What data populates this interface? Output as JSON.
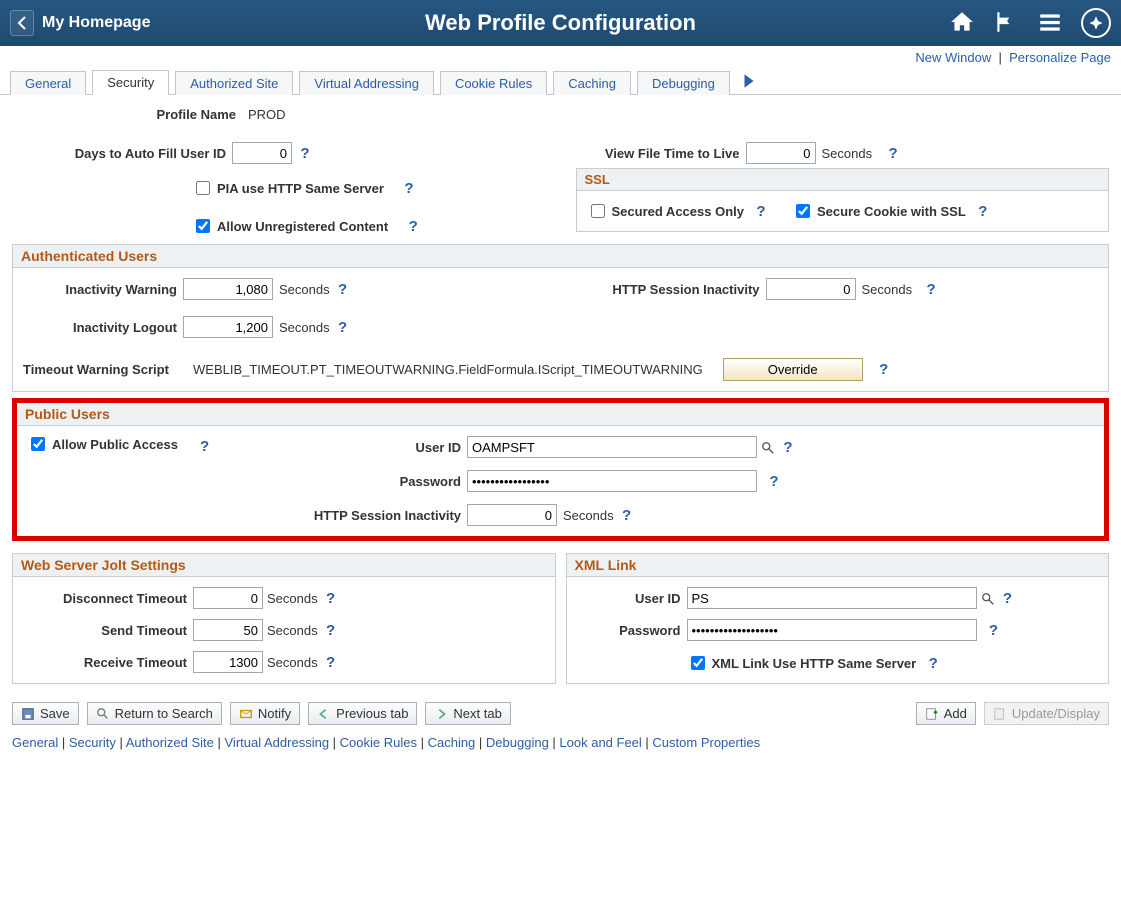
{
  "header": {
    "homepage_label": "My Homepage",
    "page_title": "Web Profile Configuration"
  },
  "toplinks": {
    "new_window": "New Window",
    "personalize": "Personalize Page"
  },
  "tabs": {
    "items": [
      "General",
      "Security",
      "Authorized Site",
      "Virtual Addressing",
      "Cookie Rules",
      "Caching",
      "Debugging"
    ],
    "active_index": 1
  },
  "profile": {
    "name_label": "Profile Name",
    "name_value": "PROD"
  },
  "top_form": {
    "days_autofill_label": "Days to Auto Fill User ID",
    "days_autofill_value": "0",
    "pia_same_server_label": "PIA use HTTP Same Server",
    "pia_same_server_checked": false,
    "allow_unreg_label": "Allow Unregistered Content",
    "allow_unreg_checked": true,
    "view_file_ttl_label": "View File Time to Live",
    "view_file_ttl_value": "0",
    "seconds_label": "Seconds"
  },
  "ssl": {
    "title": "SSL",
    "secured_only_label": "Secured Access Only",
    "secured_only_checked": false,
    "secure_cookie_label": "Secure Cookie with SSL",
    "secure_cookie_checked": true
  },
  "auth_users": {
    "title": "Authenticated Users",
    "inactivity_warning_label": "Inactivity Warning",
    "inactivity_warning_value": "1,080",
    "inactivity_logout_label": "Inactivity Logout",
    "inactivity_logout_value": "1,200",
    "seconds_label": "Seconds",
    "http_session_label": "HTTP Session Inactivity",
    "http_session_value": "0",
    "timeout_script_label": "Timeout Warning Script",
    "timeout_script_value": "WEBLIB_TIMEOUT.PT_TIMEOUTWARNING.FieldFormula.IScript_TIMEOUTWARNING",
    "override_label": "Override"
  },
  "public_users": {
    "title": "Public Users",
    "allow_public_label": "Allow Public Access",
    "allow_public_checked": true,
    "user_id_label": "User ID",
    "user_id_value": "OAMPSFT",
    "password_label": "Password",
    "password_value": "•••••••••••••••••",
    "http_session_label": "HTTP Session Inactivity",
    "http_session_value": "0",
    "seconds_label": "Seconds"
  },
  "jolt": {
    "title": "Web Server Jolt Settings",
    "disconnect_label": "Disconnect Timeout",
    "disconnect_value": "0",
    "send_label": "Send Timeout",
    "send_value": "50",
    "receive_label": "Receive Timeout",
    "receive_value": "1300",
    "seconds_label": "Seconds"
  },
  "xml": {
    "title": "XML Link",
    "user_id_label": "User ID",
    "user_id_value": "PS",
    "password_label": "Password",
    "password_value": "•••••••••••••••••••",
    "same_server_label": "XML Link Use HTTP Same Server",
    "same_server_checked": true
  },
  "toolbar": {
    "save": "Save",
    "return": "Return to Search",
    "notify": "Notify",
    "prev_tab": "Previous tab",
    "next_tab": "Next tab",
    "add": "Add",
    "update": "Update/Display"
  },
  "footer": {
    "links": [
      "General",
      "Security",
      "Authorized Site",
      "Virtual Addressing",
      "Cookie Rules",
      "Caching",
      "Debugging",
      "Look and Feel",
      "Custom Properties"
    ]
  }
}
